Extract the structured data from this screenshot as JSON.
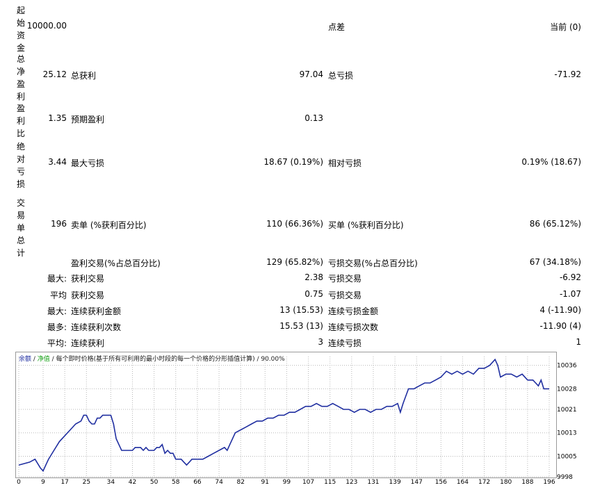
{
  "labels": {
    "initial_deposit": "起始资金",
    "total_net_profit": "总净盈利",
    "profit_factor": "盈利比",
    "absolute_drawdown": "绝对亏损",
    "total_trades": "交易单总计"
  },
  "values": {
    "initial_deposit": "10000.00",
    "total_net_profit": "25.12",
    "profit_factor": "1.35",
    "absolute_drawdown": "3.44",
    "total_trades": "196"
  },
  "spread": {
    "label": "点差",
    "value": "当前 (0)"
  },
  "gross": {
    "profit_label": "总获利",
    "profit_value": "97.04",
    "loss_label": "总亏损",
    "loss_value": "-71.92"
  },
  "expected": {
    "label": "预期盈利",
    "value": "0.13"
  },
  "drawdown": {
    "max_label": "最大亏损",
    "max_value": "18.67 (0.19%)",
    "rel_label": "相对亏损",
    "rel_value": "0.19% (18.67)"
  },
  "trades": {
    "short_label": "卖单 (%获利百分比)",
    "short_value": "110 (66.36%)",
    "long_label": "买单 (%获利百分比)",
    "long_value": "86 (65.12%)"
  },
  "rows": [
    {
      "prefix": "",
      "l1": "盈利交易(%占总百分比)",
      "v1": "129 (65.82%)",
      "l2": "亏损交易(%占总百分比)",
      "v2": "67 (34.18%)"
    },
    {
      "prefix": "最大:",
      "l1": "获利交易",
      "v1": "2.38",
      "l2": "亏损交易",
      "v2": "-6.92"
    },
    {
      "prefix": "平均",
      "l1": "获利交易",
      "v1": "0.75",
      "l2": "亏损交易",
      "v2": "-1.07"
    },
    {
      "prefix": "最大:",
      "l1": "连续获利金额",
      "v1": "13 (15.53)",
      "l2": "连续亏损金额",
      "v2": "4 (-11.90)"
    },
    {
      "prefix": "最多:",
      "l1": "连续获利次数",
      "v1": "15.53 (13)",
      "l2": "连续亏损次数",
      "v2": "-11.90 (4)"
    },
    {
      "prefix": "平均:",
      "l1": "连续获利",
      "v1": "3",
      "l2": "连续亏损",
      "v2": "1"
    }
  ],
  "chart_header": {
    "balance": "余额",
    "sep1": " / ",
    "equity": "净值",
    "sep2": " / ",
    "model": "每个即时价格(基于所有可利用的最小时段的每一个价格的分形插值计算)",
    "sep3": " / ",
    "quality": "90.00%"
  },
  "colors": {
    "balance": "#1f2ea0",
    "equity": "#1aa31a",
    "grid": "#b8b8b8"
  },
  "chart_data": {
    "type": "line",
    "x_ticks": [
      "0",
      "9",
      "17",
      "25",
      "34",
      "42",
      "50",
      "58",
      "66",
      "74",
      "82",
      "91",
      "99",
      "107",
      "115",
      "123",
      "131",
      "139",
      "147",
      "156",
      "164",
      "172",
      "180",
      "188",
      "196"
    ],
    "y_ticks": [
      "10036",
      "10028",
      "10021",
      "10013",
      "10005",
      "9998"
    ],
    "xlim": [
      0,
      196
    ],
    "ylim": [
      9998,
      10039
    ],
    "series": [
      {
        "x": [
          0,
          4,
          6,
          8,
          9,
          10,
          11,
          13,
          15,
          17,
          19,
          21,
          23,
          24,
          25,
          26,
          27,
          28,
          29,
          30,
          31,
          32,
          33,
          34,
          35,
          36,
          37,
          38,
          39,
          40,
          41,
          42,
          43,
          44,
          45,
          46,
          47,
          48,
          49,
          50,
          51,
          52,
          53,
          54,
          55,
          56,
          57,
          58,
          59,
          60,
          61,
          62,
          63,
          64,
          65,
          66,
          68,
          70,
          72,
          74,
          76,
          77,
          78,
          80,
          82,
          84,
          86,
          88,
          90,
          92,
          94,
          96,
          98,
          100,
          102,
          104,
          106,
          108,
          110,
          112,
          114,
          116,
          118,
          120,
          122,
          124,
          126,
          128,
          130,
          132,
          134,
          136,
          138,
          140,
          141,
          142,
          144,
          146,
          148,
          150,
          152,
          154,
          156,
          158,
          160,
          162,
          164,
          166,
          168,
          170,
          172,
          174,
          176,
          177,
          178,
          180,
          182,
          184,
          186,
          188,
          190,
          191,
          192,
          193,
          194,
          195,
          196
        ],
        "y": [
          10002,
          10003,
          10004,
          10001,
          10000,
          10002,
          10004,
          10007,
          10010,
          10012,
          10014,
          10016,
          10017,
          10019,
          10019,
          10017,
          10016,
          10016,
          10018,
          10018,
          10019,
          10019,
          10019,
          10019,
          10016,
          10011,
          10009,
          10007,
          10007,
          10007,
          10007,
          10007,
          10008,
          10008,
          10008,
          10007,
          10008,
          10007,
          10007,
          10007,
          10008,
          10008,
          10009,
          10006,
          10007,
          10006,
          10006,
          10004,
          10004,
          10004,
          10003,
          10002,
          10003,
          10004,
          10004,
          10004,
          10004,
          10005,
          10006,
          10007,
          10008,
          10007,
          10009,
          10013,
          10014,
          10015,
          10016,
          10017,
          10017,
          10018,
          10018,
          10019,
          10019,
          10020,
          10020,
          10021,
          10022,
          10022,
          10023,
          10022,
          10022,
          10023,
          10022,
          10021,
          10021,
          10020,
          10021,
          10021,
          10020,
          10021,
          10021,
          10022,
          10022,
          10023,
          10020,
          10023,
          10028,
          10028,
          10029,
          10030,
          10030,
          10031,
          10032,
          10034,
          10033,
          10034,
          10033,
          10034,
          10033,
          10035,
          10035,
          10036,
          10038,
          10036,
          10032,
          10033,
          10033,
          10032,
          10033,
          10031,
          10031,
          10030,
          10029,
          10031,
          10028,
          10028,
          10028
        ]
      }
    ]
  }
}
